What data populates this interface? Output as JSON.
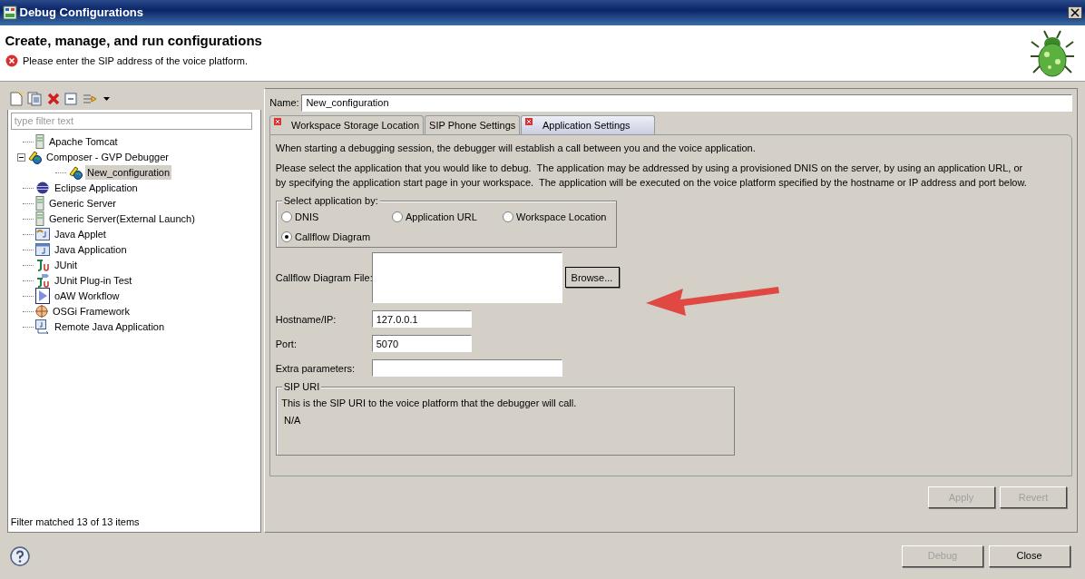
{
  "window": {
    "title": "Debug Configurations"
  },
  "header": {
    "title": "Create, manage, and run configurations",
    "error_message": "Please enter the SIP address of the voice platform."
  },
  "sidebar": {
    "filter": {
      "placeholder": "type filter text"
    },
    "tree": [
      {
        "label": "Apache Tomcat",
        "kind": "server",
        "selected": false
      },
      {
        "label": "Composer - GVP Debugger",
        "kind": "phone",
        "selected": false,
        "expanded": true,
        "children": [
          {
            "label": "New_configuration",
            "kind": "phone",
            "selected": true
          }
        ]
      },
      {
        "label": "Eclipse Application",
        "kind": "sphere",
        "selected": false
      },
      {
        "label": "Generic Server",
        "kind": "server",
        "selected": false
      },
      {
        "label": "Generic Server(External Launch)",
        "kind": "server",
        "selected": false
      },
      {
        "label": "Java Applet",
        "kind": "applet",
        "selected": false
      },
      {
        "label": "Java Application",
        "kind": "app",
        "selected": false
      },
      {
        "label": "JUnit",
        "kind": "test",
        "selected": false
      },
      {
        "label": "JUnit Plug-in Test",
        "kind": "plugin-test",
        "selected": false
      },
      {
        "label": "oAW Workflow",
        "kind": "play",
        "selected": false
      },
      {
        "label": "OSGi Framework",
        "kind": "crosshair",
        "selected": false
      },
      {
        "label": "Remote Java Application",
        "kind": "remote",
        "selected": false
      }
    ],
    "status": "Filter matched 13 of 13 items"
  },
  "editor": {
    "name_label": "Name:",
    "name_value": "New_configuration",
    "tabs": [
      {
        "label": "Workspace Storage Location",
        "error": true,
        "selected": false
      },
      {
        "label": "SIP Phone Settings",
        "error": false,
        "selected": false
      },
      {
        "label": "Application Settings",
        "error": true,
        "selected": true
      }
    ],
    "intro": "When starting a debugging session, the debugger will establish a call between you and the voice application.",
    "description": "Please select the application that you would like to debug.  The application may be addressed by using a provisioned DNIS on the server, by using an application URL, or by specifying the application start page in your workspace.  The application will be executed on the voice platform specified by the hostname or IP address and port below.",
    "select_group": {
      "title": "Select application by:",
      "options": [
        {
          "label": "DNIS",
          "selected": false
        },
        {
          "label": "Application URL",
          "selected": false
        },
        {
          "label": "Workspace Location",
          "selected": false
        },
        {
          "label": "Callflow Diagram",
          "selected": true
        }
      ]
    },
    "callflow_file": {
      "label": "Callflow Diagram File:",
      "button": "Browse..."
    },
    "fields": [
      {
        "label": "Hostname/IP:",
        "value": "127.0.0.1"
      },
      {
        "label": "Port:",
        "value": "5070"
      },
      {
        "label": "Extra parameters:"
      }
    ],
    "sip_uri": {
      "title": "SIP URI",
      "text": "This is the SIP URI to the voice platform that the debugger will call.",
      "value": "N/A"
    },
    "buttons": [
      {
        "label": "Apply",
        "disabled": true
      },
      {
        "label": "Revert",
        "disabled": true
      }
    ]
  },
  "footer_buttons": [
    {
      "label": "Debug",
      "disabled": true
    },
    {
      "label": "Close",
      "disabled": false
    }
  ]
}
